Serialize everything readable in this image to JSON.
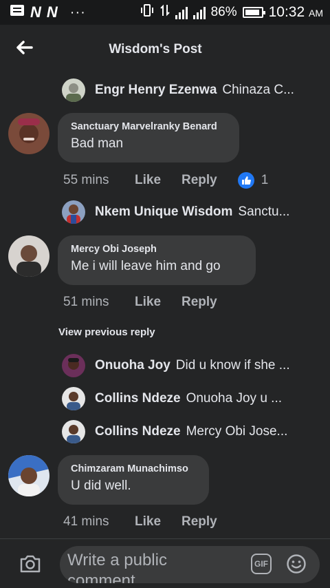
{
  "status_bar": {
    "battery": "86%",
    "time": "10:32",
    "ampm": "AM",
    "dots": "···"
  },
  "header": {
    "title": "Wisdom's Post"
  },
  "replies_top": [
    {
      "author": "Engr Henry Ezenwa",
      "snippet": "Chinaza C..."
    }
  ],
  "comments": [
    {
      "author": "Sanctuary Marvelranky Benard",
      "text": "Bad man",
      "time": "55 mins",
      "like": "Like",
      "reply": "Reply",
      "reaction_count": "1"
    },
    {
      "author": "Mercy Obi Joseph",
      "text": "Me i will leave him and go",
      "time": "51 mins",
      "like": "Like",
      "reply": "Reply"
    },
    {
      "author": "Chimzaram Munachimso",
      "text": "U did well.",
      "time": "41 mins",
      "like": "Like",
      "reply": "Reply"
    }
  ],
  "reply_after_first": {
    "author": "Nkem Unique Wisdom",
    "snippet": "Sanctu..."
  },
  "view_previous": "View previous reply",
  "replies_middle": [
    {
      "author": "Onuoha Joy",
      "snippet": "Did u know if she ..."
    },
    {
      "author": "Collins Ndeze",
      "snippet": "Onuoha Joy  u ..."
    },
    {
      "author": "Collins Ndeze",
      "snippet": "Mercy Obi Jose..."
    }
  ],
  "composer": {
    "placeholder": "Write a public comment",
    "gif_label": "GIF"
  },
  "colors": {
    "background": "#242526",
    "bubble": "#3a3b3c",
    "like_blue": "#2078f4",
    "muted": "#b0b3b8"
  }
}
